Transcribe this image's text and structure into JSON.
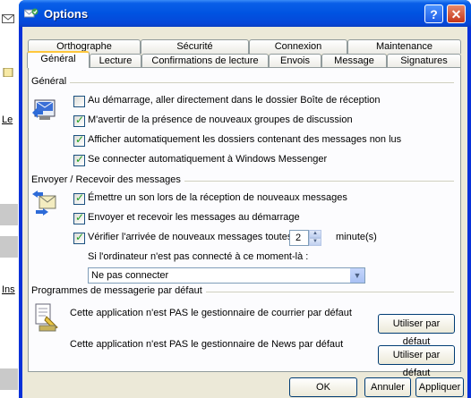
{
  "window": {
    "title": "Options"
  },
  "tabs_row1": [
    "Orthographe",
    "Sécurité",
    "Connexion",
    "Maintenance"
  ],
  "tabs_row2": [
    "Général",
    "Lecture",
    "Confirmations de lecture",
    "Envois",
    "Message",
    "Signatures"
  ],
  "active_tab": "Général",
  "general_group": {
    "label": "Général",
    "options": [
      {
        "label": "Au démarrage, aller directement dans le dossier Boîte de réception",
        "checked": false
      },
      {
        "label": "M'avertir de la présence de nouveaux groupes de discussion",
        "checked": true
      },
      {
        "label": "Afficher automatiquement les dossiers contenant des messages non lus",
        "checked": true
      },
      {
        "label": "Se connecter automatiquement à Windows Messenger",
        "checked": true
      }
    ]
  },
  "sendrecv_group": {
    "label": "Envoyer / Recevoir des messages",
    "options": [
      {
        "label": "Émettre un son lors de la réception de nouveaux messages",
        "checked": true
      },
      {
        "label": "Envoyer et recevoir les messages au démarrage",
        "checked": true
      },
      {
        "label": "Vérifier l'arrivée de nouveaux messages toutes les",
        "checked": true
      }
    ],
    "interval_value": "2",
    "interval_unit": "minute(s)",
    "offline_label": "Si l'ordinateur n'est pas connecté à ce moment-là :",
    "offline_selected": "Ne pas connecter"
  },
  "default_programs_group": {
    "label": "Programmes de messagerie par défaut",
    "mail_text": "Cette application n'est PAS le gestionnaire de courrier par défaut",
    "news_text": "Cette application n'est PAS le gestionnaire de News par défaut",
    "make_default_label": "Utiliser par défaut"
  },
  "footer": {
    "ok": "OK",
    "cancel": "Annuler",
    "apply": "Appliquer"
  },
  "background": {
    "text1": "Le",
    "text2": "Ins"
  }
}
